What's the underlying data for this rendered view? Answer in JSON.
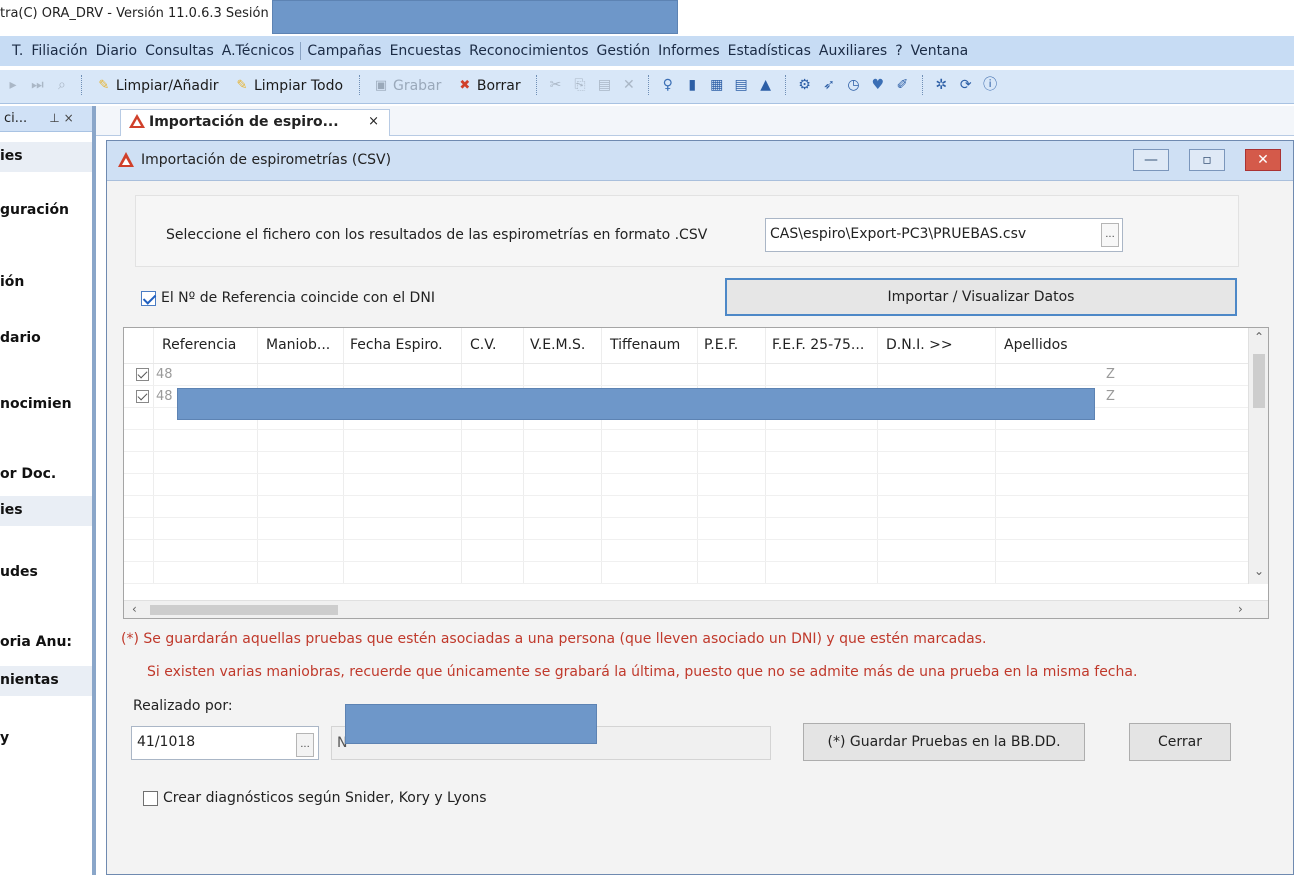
{
  "window_title": "tra(C) ORA_DRV - Versión 11.0.6.3  Sesión iniciada por",
  "menu": [
    "T.",
    "Filiación",
    "Diario",
    "Consultas",
    "A.Técnicos",
    "Campañas",
    "Encuestas",
    "Reconocimientos",
    "Gestión",
    "Informes",
    "Estadísticas",
    "Auxiliares",
    "?",
    "Ventana"
  ],
  "toolbar": {
    "limpiar_anadir": "Limpiar/Añadir",
    "limpiar_todo": "Limpiar Todo",
    "grabar": "Grabar",
    "borrar": "Borrar"
  },
  "left_panel": {
    "header": "ci...",
    "items": [
      "ies",
      "guración",
      "ión",
      "dario",
      "nocimien",
      "or Doc.",
      "ies",
      "udes",
      "oria Anu:",
      "nientas",
      "y"
    ]
  },
  "tab": {
    "label": "Importación de espiro...",
    "close": "×"
  },
  "dialog": {
    "title": "Importación de espirometrías (CSV)",
    "file_prompt": "Seleccione el fichero con los resultados de las espirometrías en formato .CSV",
    "file_path": "CAS\\espiro\\Export-PC3\\PRUEBAS.csv",
    "browse": "...",
    "ref_dni_label": "El Nº de Referencia coincide con el DNI",
    "import_button": "Importar / Visualizar Datos",
    "columns": [
      "Referencia",
      "Maniob...",
      "Fecha Espiro.",
      "C.V.",
      "V.E.M.S.",
      "Tiffenaum",
      "P.E.F.",
      "F.E.F. 25-75...",
      "D.N.I. >>",
      "Apellidos"
    ],
    "rows": [
      {
        "ref": "48",
        "apellidos": "Z"
      },
      {
        "ref": "48",
        "apellidos": "Z"
      }
    ],
    "note1": "(*) Se guardarán aquellas pruebas que estén asociadas a una persona (que lleven asociado un DNI) y que estén marcadas.",
    "note2": "Si existen varias maniobras, recuerde que únicamente se grabará la última, puesto que no se admite más de una prueba en la misma fecha.",
    "realizado_label": "Realizado por:",
    "realizado_value": "41/1018",
    "realizado_name_fragment": "N",
    "save_button": "(*) Guardar Pruebas en la BB.DD.",
    "close_button": "Cerrar",
    "diag_label": "Crear diagnósticos según Snider, Kory y Lyons"
  }
}
